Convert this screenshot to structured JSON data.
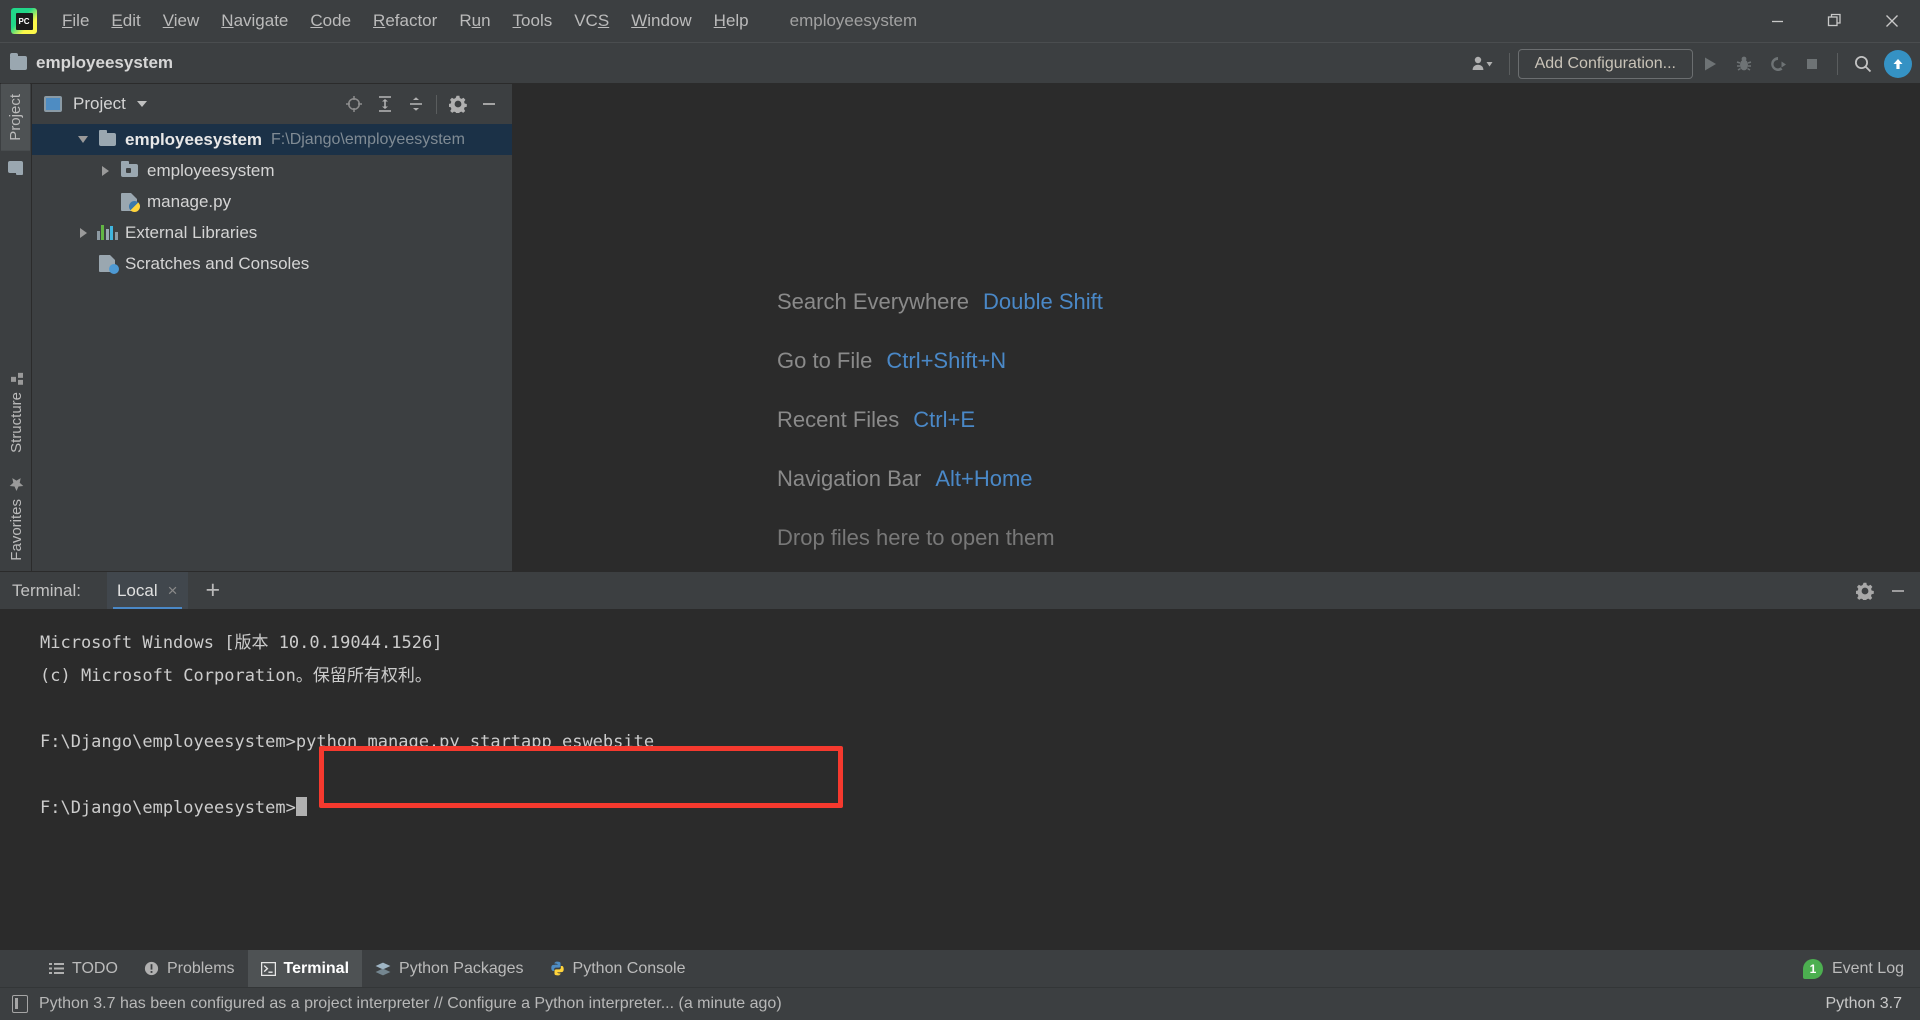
{
  "window": {
    "project_title": "employeesystem",
    "controls": {
      "minimize": "minimize-icon",
      "maximize": "restore-icon",
      "close": "close-icon"
    }
  },
  "menubar": {
    "logo": "pycharm-logo",
    "logo_text": "PC",
    "items": [
      {
        "label": "File",
        "mnemonic": "F"
      },
      {
        "label": "Edit",
        "mnemonic": "E"
      },
      {
        "label": "View",
        "mnemonic": "V"
      },
      {
        "label": "Navigate",
        "mnemonic": "N"
      },
      {
        "label": "Code",
        "mnemonic": "C"
      },
      {
        "label": "Refactor",
        "mnemonic": "R"
      },
      {
        "label": "Run",
        "mnemonic": "u"
      },
      {
        "label": "Tools",
        "mnemonic": "T"
      },
      {
        "label": "VCS",
        "mnemonic": "S"
      },
      {
        "label": "Window",
        "mnemonic": "W"
      },
      {
        "label": "Help",
        "mnemonic": "H"
      }
    ]
  },
  "toolbar": {
    "project_label": "employeesystem",
    "add_configuration_label": "Add Configuration...",
    "icons": [
      "folder-icon",
      "user-dropdown-icon",
      "run-icon",
      "debug-icon",
      "run-coverage-icon",
      "stop-icon",
      "search-icon",
      "update-icon"
    ]
  },
  "left_strip": {
    "top_tabs": [
      {
        "label": "Project",
        "icon": "project-window-icon",
        "active": true
      }
    ],
    "bottom_tabs": [
      {
        "label": "Structure",
        "icon": "structure-icon"
      },
      {
        "label": "Favorites",
        "icon": "star-icon"
      }
    ]
  },
  "project_pane": {
    "title": "Project",
    "tool_icons": [
      "locate-icon",
      "expand-all-icon",
      "collapse-all-icon",
      "gear-icon",
      "hide-icon"
    ],
    "tree": [
      {
        "label": "employeesystem",
        "path": "F:\\Django\\employeesystem",
        "icon": "folder-icon",
        "indent": 0,
        "arrow": "open",
        "selected": true,
        "bold": true
      },
      {
        "label": "employeesystem",
        "path": "",
        "icon": "module-folder-icon",
        "indent": 1,
        "arrow": "closed",
        "selected": false,
        "bold": false
      },
      {
        "label": "manage.py",
        "path": "",
        "icon": "python-file-icon",
        "indent": 1,
        "arrow": "none",
        "selected": false,
        "bold": false
      },
      {
        "label": "External Libraries",
        "path": "",
        "icon": "libraries-icon",
        "indent": 0,
        "arrow": "closed",
        "selected": false,
        "bold": false
      },
      {
        "label": "Scratches and Consoles",
        "path": "",
        "icon": "scratches-icon",
        "indent": 0,
        "arrow": "none",
        "selected": false,
        "bold": false
      }
    ]
  },
  "editor": {
    "hints": [
      {
        "action": "Search Everywhere",
        "shortcut": "Double Shift"
      },
      {
        "action": "Go to File",
        "shortcut": "Ctrl+Shift+N"
      },
      {
        "action": "Recent Files",
        "shortcut": "Ctrl+E"
      },
      {
        "action": "Navigation Bar",
        "shortcut": "Alt+Home"
      }
    ],
    "drop_hint": "Drop files here to open them"
  },
  "terminal": {
    "label": "Terminal:",
    "tabs": [
      {
        "label": "Local",
        "close": "×",
        "active": true
      }
    ],
    "add_tab": "+",
    "tool_icons": [
      "gear-icon",
      "hide-icon"
    ],
    "lines": [
      "Microsoft Windows [版本 10.0.19044.1526]",
      "(c) Microsoft Corporation。保留所有权利。",
      "",
      "F:\\Django\\employeesystem>python manage.py startapp eswebsite",
      "",
      "F:\\Django\\employeesystem>"
    ],
    "prompt": "F:\\Django\\employeesystem>",
    "command_line": "F:\\Django\\employeesystem>python manage.py startapp eswebsite",
    "highlight_color": "#f5392e"
  },
  "bottom_tabs": [
    {
      "label": "TODO",
      "icon": "todo-icon",
      "active": false
    },
    {
      "label": "Problems",
      "icon": "problems-icon",
      "active": false
    },
    {
      "label": "Terminal",
      "icon": "terminal-icon",
      "active": true
    },
    {
      "label": "Python Packages",
      "icon": "packages-icon",
      "active": false
    },
    {
      "label": "Python Console",
      "icon": "python-console-icon",
      "active": false
    }
  ],
  "event_log": {
    "count": "1",
    "label": "Event Log"
  },
  "statusbar": {
    "message": "Python 3.7 has been configured as a project interpreter // Configure a Python interpreter... (a minute ago)",
    "interpreter": "Python 3.7"
  },
  "colors": {
    "accent_blue": "#4a88c7",
    "panel_bg": "#3c3f41",
    "editor_bg": "#2b2b2b",
    "selection_bg": "#1b3147",
    "highlight_red": "#f5392e",
    "badge_green": "#4caf50"
  }
}
